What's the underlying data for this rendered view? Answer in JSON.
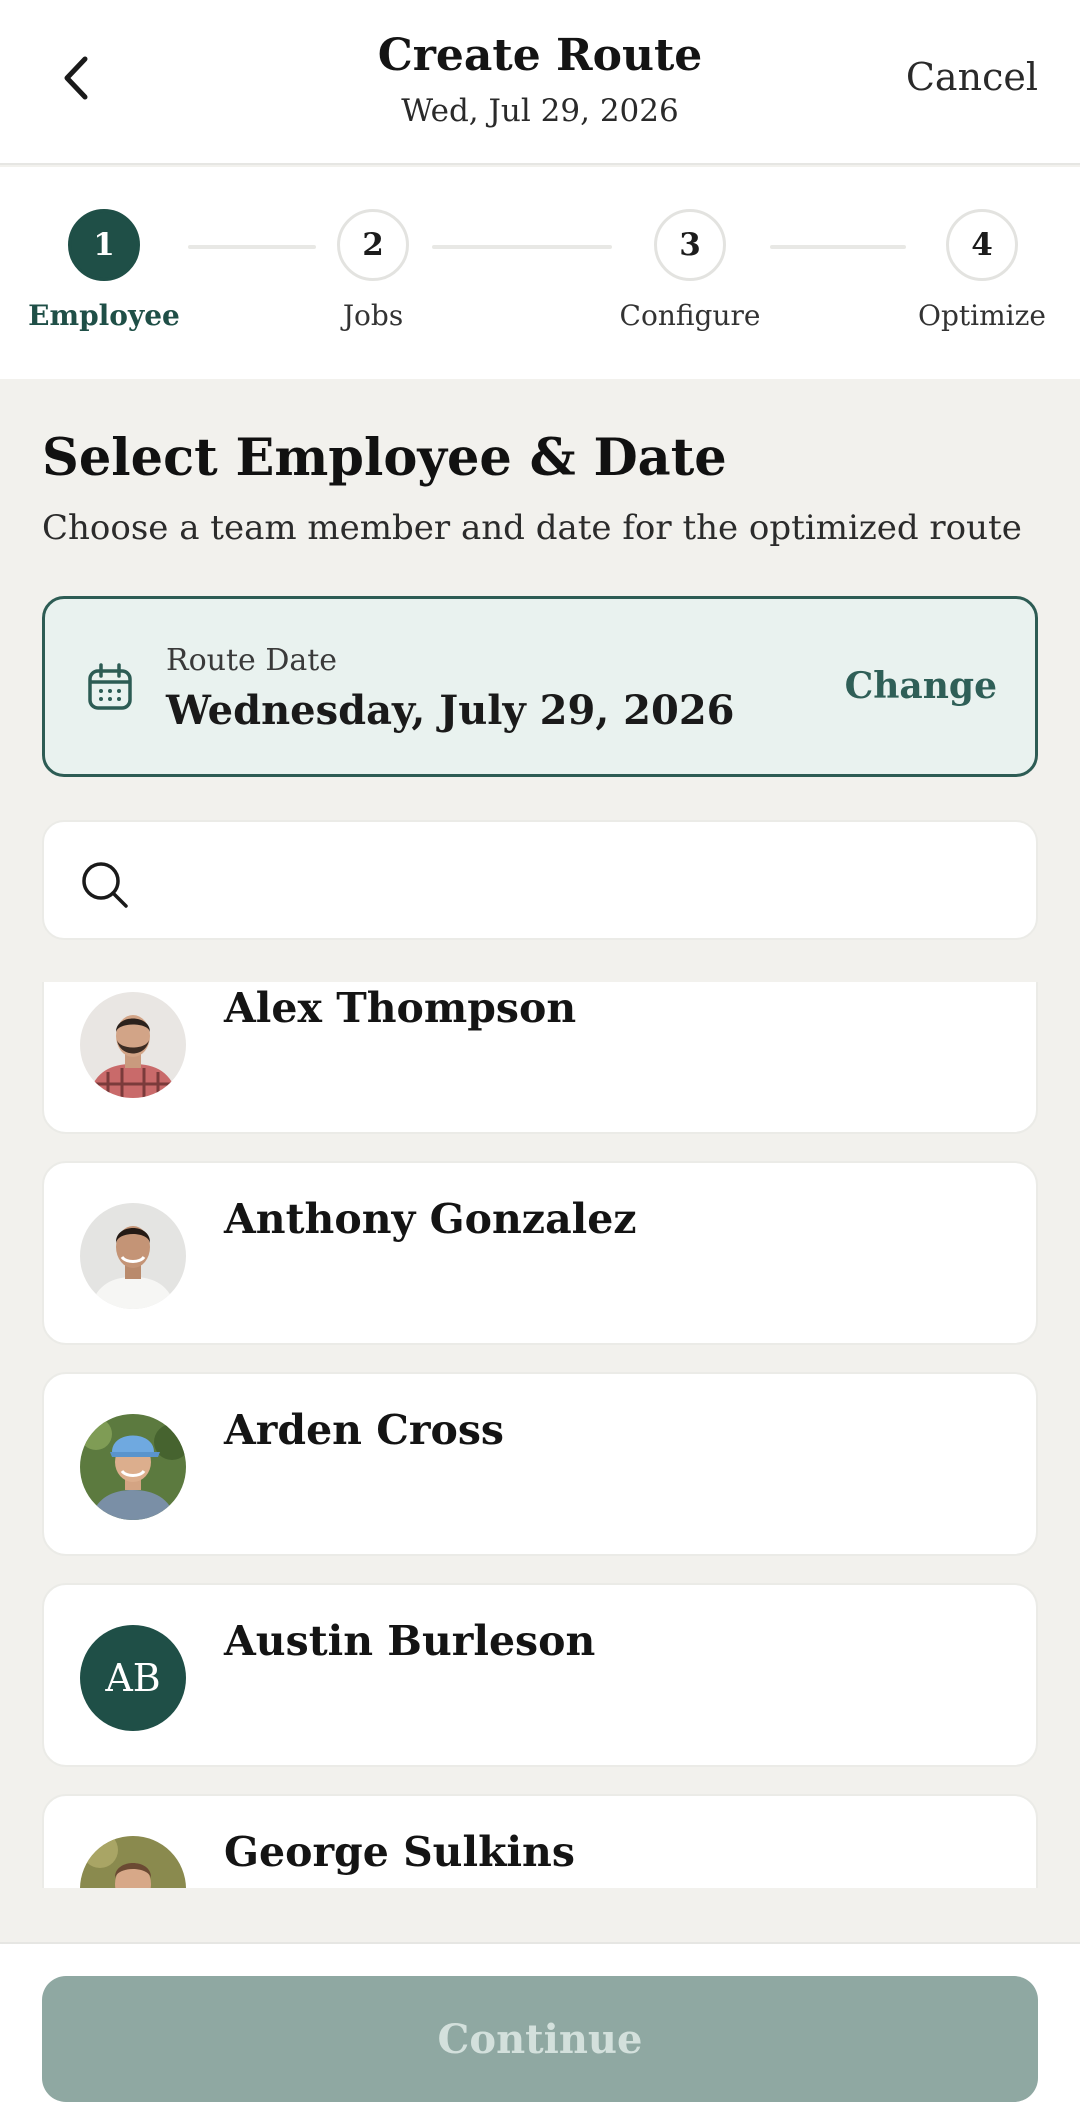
{
  "header": {
    "title": "Create Route",
    "subtitle": "Wed, Jul 29, 2026",
    "cancel_label": "Cancel",
    "back_icon": "chevron-left-icon"
  },
  "stepper": {
    "steps": [
      {
        "number": "1",
        "label": "Employee",
        "state": "active"
      },
      {
        "number": "2",
        "label": "Jobs",
        "state": "upcoming"
      },
      {
        "number": "3",
        "label": "Configure",
        "state": "upcoming"
      },
      {
        "number": "4",
        "label": "Optimize",
        "state": "upcoming"
      }
    ]
  },
  "content": {
    "title": "Select Employee & Date",
    "subtitle": "Choose a team member and date for the optimized route"
  },
  "route_date": {
    "icon": "calendar-icon",
    "label": "Route Date",
    "value": "Wednesday, July 29, 2026",
    "change_label": "Change"
  },
  "search": {
    "icon": "search-icon",
    "placeholder": "",
    "value": ""
  },
  "employees": [
    {
      "name": "Alex Thompson",
      "avatar": "photo"
    },
    {
      "name": "Anthony Gonzalez",
      "avatar": "photo"
    },
    {
      "name": "Arden Cross",
      "avatar": "photo"
    },
    {
      "name": "Austin Burleson",
      "avatar": "initials",
      "initials": "AB"
    },
    {
      "name": "George Sulkins",
      "avatar": "photo"
    }
  ],
  "footer": {
    "continue_label": "Continue"
  },
  "colors": {
    "brand": "#1f4f47",
    "date_card_bg": "#e9f2ef",
    "continue_disabled": "#8fa8a2",
    "page_bg": "#f2f1ed"
  }
}
